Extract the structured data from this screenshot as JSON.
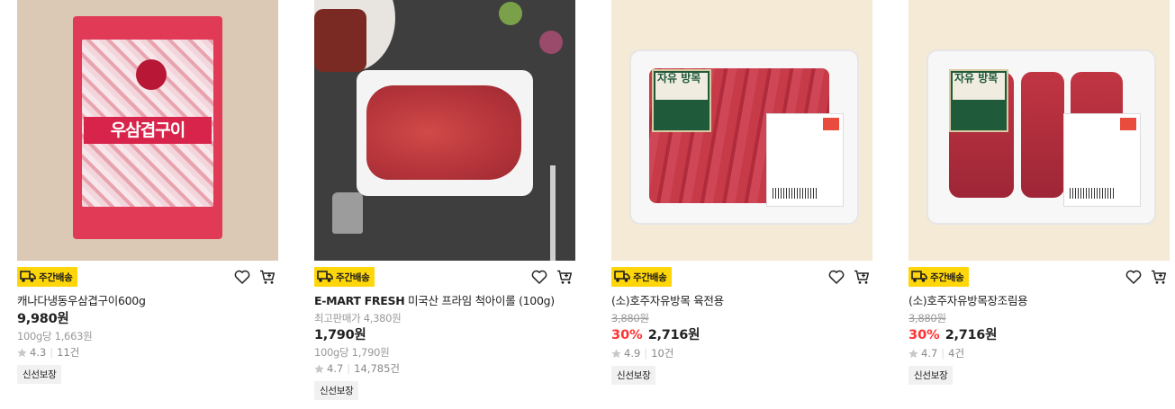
{
  "common": {
    "delivery_badge": "주간배송",
    "colors": {
      "badge_bg": "#ffd60a",
      "discount": "#ff3333",
      "chip_bg": "#f1f1f1"
    },
    "icons": [
      "truck-icon",
      "heart-icon",
      "cart-icon",
      "star-icon"
    ]
  },
  "products": [
    {
      "title": "캐나다냉동우삼겹구이600g",
      "price": "9,980원",
      "unit_price": "100g당 1,663원",
      "rating": "4.3",
      "reviews": "11건",
      "chip": "신선보장",
      "image_text": "우삼겹구이"
    },
    {
      "brand": "E-MART FRESH",
      "title": "미국산 프라임 척아이롤 (100g)",
      "orig_label": "최고판매가 4,380원",
      "price": "1,790원",
      "unit_price": "100g당 1,790원",
      "rating": "4.7",
      "reviews": "14,785건",
      "chip": "신선보장"
    },
    {
      "title": "(소)호주자유방목 육전용",
      "orig_price": "3,880원",
      "discount": "30%",
      "price": "2,716원",
      "rating": "4.9",
      "reviews": "10건",
      "chip": "신선보장",
      "label_text": "자유 방목"
    },
    {
      "title": "(소)호주자유방목장조림용",
      "orig_price": "3,880원",
      "discount": "30%",
      "price": "2,716원",
      "rating": "4.7",
      "reviews": "4건",
      "chip": "신선보장",
      "label_text": "자유 방목"
    }
  ]
}
